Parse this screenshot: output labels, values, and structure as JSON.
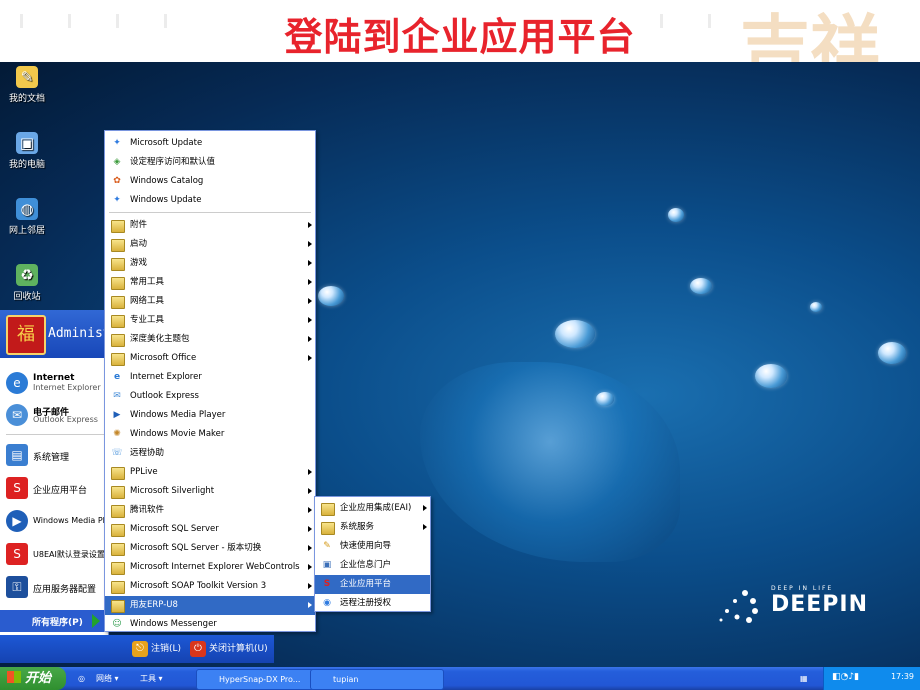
{
  "slide": {
    "title": "登陆到企业应用平台"
  },
  "desktop_icons": [
    {
      "label": "我的文档",
      "icon": "documents-icon"
    },
    {
      "label": "我的电脑",
      "icon": "computer-icon"
    },
    {
      "label": "网上邻居",
      "icon": "network-icon"
    },
    {
      "label": "回收站",
      "icon": "recycle-bin-icon"
    }
  ],
  "branding": {
    "tagline": "DEEP IN LIFE",
    "name": "DEEPIN"
  },
  "start_menu": {
    "user_name": "Administ",
    "pinned": [
      {
        "title": "Internet",
        "subtitle": "Internet Explorer",
        "icon": "ie-icon"
      },
      {
        "title": "电子邮件",
        "subtitle": "Outlook Express",
        "icon": "mail-icon"
      }
    ],
    "recent": [
      {
        "label": "系统管理",
        "icon": "system-manage-icon"
      },
      {
        "label": "企业应用平台",
        "icon": "ufida-icon"
      },
      {
        "label": "Windows Media Pl",
        "icon": "media-player-icon"
      },
      {
        "label": "U8EAI默认登录设置",
        "icon": "ufida-icon"
      },
      {
        "label": "应用服务器配置",
        "icon": "key-icon"
      }
    ],
    "all_programs": "所有程序(P)",
    "logoff": "注销(L)",
    "shutdown": "关闭计算机(U)"
  },
  "programs_menu": {
    "items": [
      {
        "label": "Microsoft Update",
        "icon": "update-icon",
        "submenu": false
      },
      {
        "label": "设定程序访问和默认值",
        "icon": "defaults-icon",
        "submenu": false
      },
      {
        "label": "Windows Catalog",
        "icon": "catalog-icon",
        "submenu": false
      },
      {
        "label": "Windows Update",
        "icon": "update-icon",
        "submenu": false
      },
      {
        "label": "附件",
        "icon": "folder-icon",
        "submenu": true
      },
      {
        "label": "启动",
        "icon": "folder-icon",
        "submenu": true
      },
      {
        "label": "游戏",
        "icon": "folder-icon",
        "submenu": true
      },
      {
        "label": "常用工具",
        "icon": "folder-icon",
        "submenu": true
      },
      {
        "label": "网络工具",
        "icon": "folder-icon",
        "submenu": true
      },
      {
        "label": "专业工具",
        "icon": "folder-icon",
        "submenu": true
      },
      {
        "label": "深度美化主题包",
        "icon": "folder-icon",
        "submenu": true
      },
      {
        "label": "Microsoft Office",
        "icon": "folder-icon",
        "submenu": true
      },
      {
        "label": "Internet Explorer",
        "icon": "ie-icon",
        "submenu": false
      },
      {
        "label": "Outlook Express",
        "icon": "mail-icon",
        "submenu": false
      },
      {
        "label": "Windows Media Player",
        "icon": "media-player-icon",
        "submenu": false
      },
      {
        "label": "Windows Movie Maker",
        "icon": "movie-maker-icon",
        "submenu": false
      },
      {
        "label": "远程协助",
        "icon": "remote-assist-icon",
        "submenu": false
      },
      {
        "label": "PPLive",
        "icon": "folder-icon",
        "submenu": true
      },
      {
        "label": "Microsoft Silverlight",
        "icon": "folder-icon",
        "submenu": true
      },
      {
        "label": "腾讯软件",
        "icon": "folder-icon",
        "submenu": true
      },
      {
        "label": "Microsoft SQL Server",
        "icon": "folder-icon",
        "submenu": true
      },
      {
        "label": "Microsoft SQL Server - 版本切换",
        "icon": "folder-icon",
        "submenu": true
      },
      {
        "label": "Microsoft Internet Explorer WebControls",
        "icon": "folder-icon",
        "submenu": true
      },
      {
        "label": "Microsoft SOAP Toolkit Version 3",
        "icon": "folder-icon",
        "submenu": true
      },
      {
        "label": "用友ERP-U8",
        "icon": "folder-icon",
        "submenu": true,
        "highlighted": true
      },
      {
        "label": "Windows Messenger",
        "icon": "messenger-icon",
        "submenu": false
      }
    ]
  },
  "u8_submenu": {
    "items": [
      {
        "label": "企业应用集成(EAI)",
        "icon": "folder-icon",
        "submenu": true
      },
      {
        "label": "系统服务",
        "icon": "folder-icon",
        "submenu": true
      },
      {
        "label": "快速使用向导",
        "icon": "wizard-icon",
        "submenu": false
      },
      {
        "label": "企业信息门户",
        "icon": "portal-icon",
        "submenu": false
      },
      {
        "label": "企业应用平台",
        "icon": "ufida-icon",
        "submenu": false,
        "highlighted": true
      },
      {
        "label": "远程注册授权",
        "icon": "register-icon",
        "submenu": false
      }
    ]
  },
  "taskbar": {
    "start_label": "开始",
    "toolbar": [
      "网络 ▾",
      "工具 ▾"
    ],
    "tasks": [
      "HyperSnap-DX Pro...",
      "tupian"
    ],
    "clock": "17:39"
  }
}
